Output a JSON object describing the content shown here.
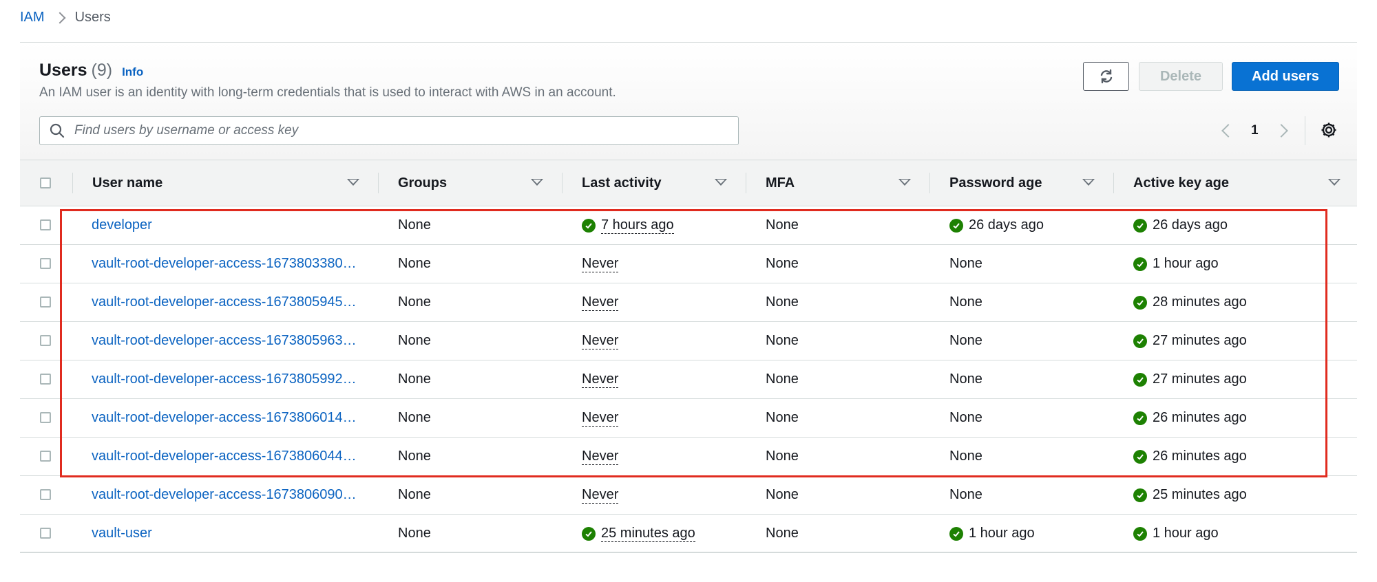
{
  "breadcrumb": {
    "root": "IAM",
    "current": "Users"
  },
  "header": {
    "title": "Users",
    "count": "(9)",
    "info": "Info",
    "description": "An IAM user is an identity with long-term credentials that is used to interact with AWS in an account."
  },
  "toolbar": {
    "refresh_icon": "refresh-icon",
    "delete_label": "Delete",
    "add_label": "Add users"
  },
  "search": {
    "placeholder": "Find users by username or access key",
    "value": ""
  },
  "pagination": {
    "current_page": "1"
  },
  "columns": [
    "User name",
    "Groups",
    "Last activity",
    "MFA",
    "Password age",
    "Active key age"
  ],
  "rows": [
    {
      "user": "developer",
      "groups": "None",
      "last_activity": "7 hours ago",
      "mfa": "None",
      "password_age": "26 days ago",
      "key_age": "26 days ago"
    },
    {
      "user": "vault-root-developer-access-1673803380…",
      "groups": "None",
      "last_activity": "Never",
      "mfa": "None",
      "password_age": "None",
      "key_age": "1 hour ago"
    },
    {
      "user": "vault-root-developer-access-1673805945…",
      "groups": "None",
      "last_activity": "Never",
      "mfa": "None",
      "password_age": "None",
      "key_age": "28 minutes ago"
    },
    {
      "user": "vault-root-developer-access-1673805963…",
      "groups": "None",
      "last_activity": "Never",
      "mfa": "None",
      "password_age": "None",
      "key_age": "27 minutes ago"
    },
    {
      "user": "vault-root-developer-access-1673805992…",
      "groups": "None",
      "last_activity": "Never",
      "mfa": "None",
      "password_age": "None",
      "key_age": "27 minutes ago"
    },
    {
      "user": "vault-root-developer-access-1673806014…",
      "groups": "None",
      "last_activity": "Never",
      "mfa": "None",
      "password_age": "None",
      "key_age": "26 minutes ago"
    },
    {
      "user": "vault-root-developer-access-1673806044…",
      "groups": "None",
      "last_activity": "Never",
      "mfa": "None",
      "password_age": "None",
      "key_age": "26 minutes ago"
    },
    {
      "user": "vault-root-developer-access-1673806090…",
      "groups": "None",
      "last_activity": "Never",
      "mfa": "None",
      "password_age": "None",
      "key_age": "25 minutes ago"
    },
    {
      "user": "vault-user",
      "groups": "None",
      "last_activity": "25 minutes ago",
      "mfa": "None",
      "password_age": "1 hour ago",
      "key_age": "1 hour ago"
    }
  ],
  "colors": {
    "link": "#0b63c1",
    "primary_button": "#0972d3",
    "success": "#1d8102",
    "highlight": "#e02b1f"
  }
}
